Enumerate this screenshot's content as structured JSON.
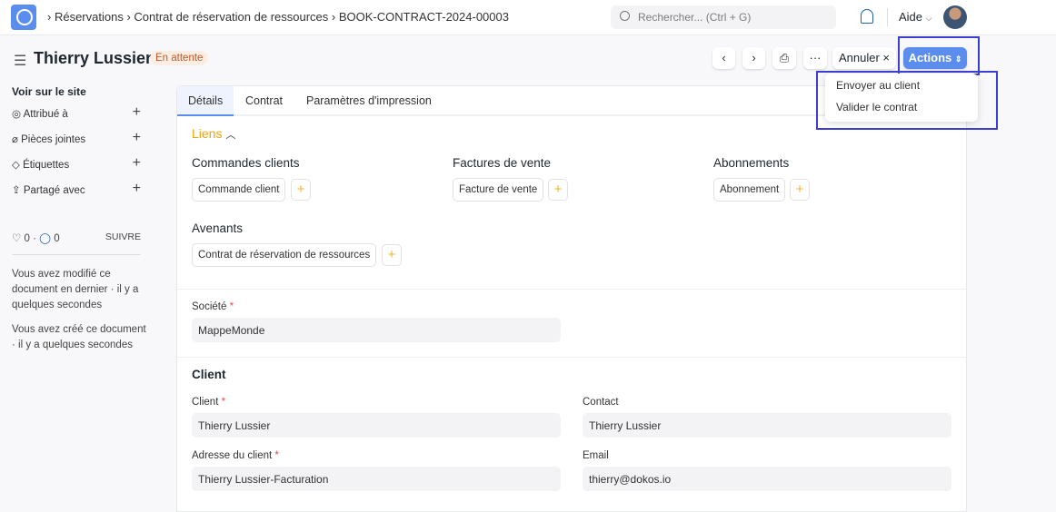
{
  "navbar": {
    "breadcrumb": [
      "Réservations",
      "Contrat de réservation de ressources",
      "BOOK-CONTRACT-2024-00003"
    ],
    "search_placeholder": "Rechercher... (Ctrl + G)",
    "help": "Aide"
  },
  "header": {
    "title": "Thierry Lussier",
    "status": "En attente",
    "cancel_label": "Annuler",
    "actions_label": "Actions"
  },
  "actions_menu": [
    "Envoyer au client",
    "Valider le contrat"
  ],
  "sidebar": {
    "heading": "Voir sur le site",
    "items": [
      {
        "label": "Attribué à"
      },
      {
        "label": "Pièces jointes"
      },
      {
        "label": "Étiquettes"
      },
      {
        "label": "Partagé avec"
      }
    ],
    "likes": "0",
    "comments": "0",
    "follow": "SUIVRE",
    "modified": "Vous avez modifié ce document en dernier · il y a quelques secondes",
    "created": "Vous avez créé ce document · il y a quelques secondes"
  },
  "tabs": [
    "Détails",
    "Contrat",
    "Paramètres d'impression"
  ],
  "links": {
    "title": "Liens",
    "groups": [
      {
        "title": "Commandes clients",
        "chip": "Commande client"
      },
      {
        "title": "Factures de vente",
        "chip": "Facture de vente"
      },
      {
        "title": "Abonnements",
        "chip": "Abonnement"
      },
      {
        "title": "Avenants",
        "chip": "Contrat de réservation de ressources"
      }
    ]
  },
  "form": {
    "company_label": "Société",
    "company": "MappeMonde",
    "client_section": "Client",
    "client_label": "Client",
    "client": "Thierry Lussier",
    "contact_label": "Contact",
    "contact": "Thierry Lussier",
    "address_label": "Adresse du client",
    "address": "Thierry Lussier-Facturation",
    "email_label": "Email",
    "email": "thierry@dokos.io"
  }
}
